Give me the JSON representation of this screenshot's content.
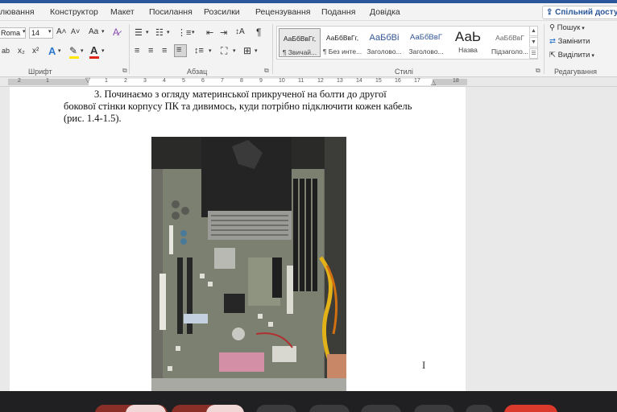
{
  "menu": {
    "items": [
      "лювання",
      "Конструктор",
      "Макет",
      "Посилання",
      "Розсилки",
      "Рецензування",
      "Подання",
      "Довідка"
    ],
    "share_label": "Спільний доступ"
  },
  "ribbon": {
    "font": {
      "name": "Roma",
      "size": "14",
      "grow": "A˄",
      "shrink": "A˅",
      "case": "Aa",
      "subscript": "x₂",
      "superscript": "x²",
      "group_label": "Шрифт"
    },
    "paragraph": {
      "group_label": "Абзац",
      "pilcrow": "¶"
    },
    "styles": {
      "items": [
        {
          "sample": "АаБбВвГг,",
          "name": "¶ Звичай..."
        },
        {
          "sample": "АаБбВвГг,",
          "name": "¶ Без инте..."
        },
        {
          "sample": "АаБбВі",
          "name": "Заголово..."
        },
        {
          "sample": "АаБбВвГ",
          "name": "Заголово..."
        },
        {
          "sample": "АаЬ",
          "name": "Назва"
        },
        {
          "sample": "АаБбВвГ",
          "name": "Підзаголо..."
        }
      ],
      "group_label": "Стилі"
    },
    "editing": {
      "find": "Пошук",
      "replace": "Замінити",
      "select": "Виділити",
      "group_label": "Редагування"
    }
  },
  "ruler": {
    "labels": [
      "2",
      "1",
      "1",
      "2",
      "3",
      "4",
      "5",
      "6",
      "7",
      "8",
      "9",
      "10",
      "11",
      "12",
      "13",
      "14",
      "15",
      "16",
      "17",
      "18"
    ]
  },
  "document": {
    "paragraph_line1": "3. Починаємо з огляду материнської прикрученої на болти до другої",
    "paragraph_line2": "бокової стінки корпусу ПК та дивимось, куди потрібно підключити кожен кабель",
    "paragraph_line3": "(рис. 1.4-1.5)."
  },
  "cursor": "I",
  "colors": {
    "accent": "#2b579a",
    "ribbon_bg": "#f3f3f3",
    "page_bg": "#ffffff",
    "workspace_bg": "#e9e9e9",
    "dock_bg": "#202022",
    "highlight_yellow": "#ffe600",
    "font_color_red": "#e0261b",
    "record_red": "#d93a2b"
  }
}
